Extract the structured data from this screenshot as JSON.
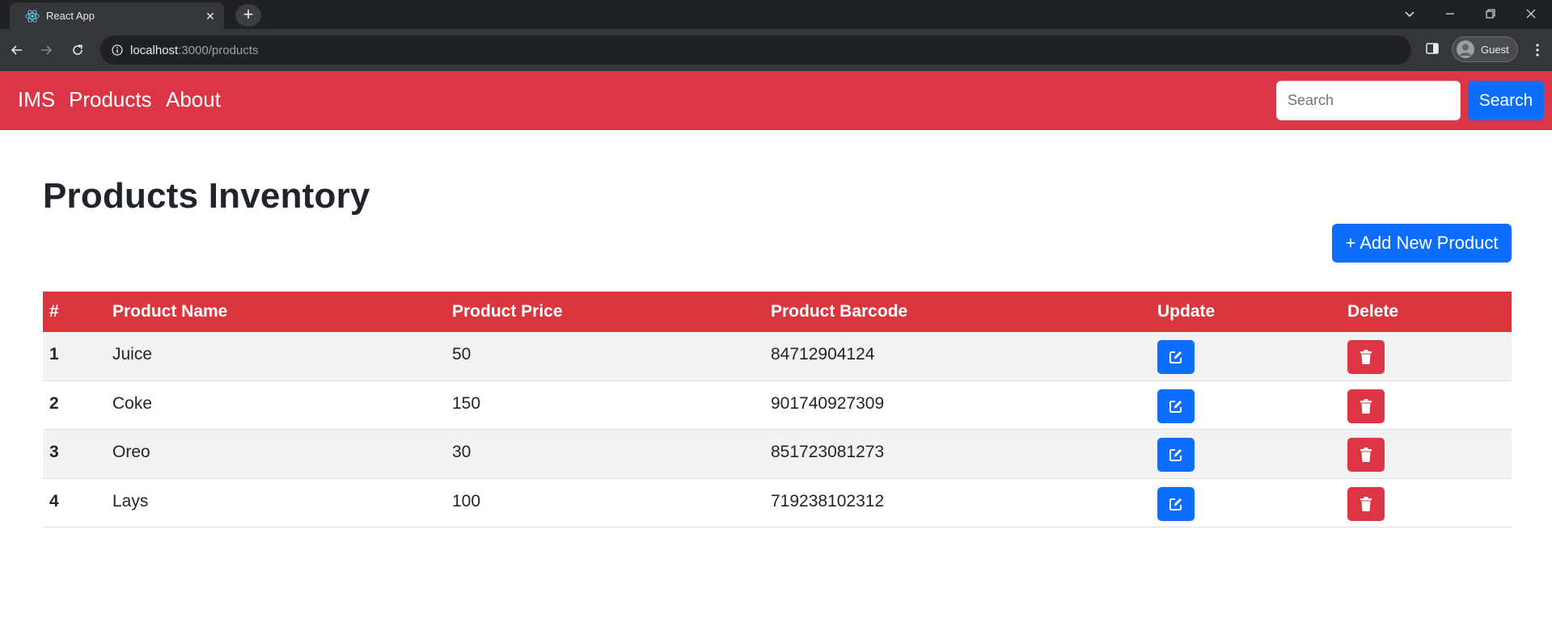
{
  "browser": {
    "tab_title": "React App",
    "tab_close_glyph": "✕",
    "new_tab_glyph": "+",
    "url_host": "localhost",
    "url_path": ":3000/products",
    "profile_label": "Guest",
    "icons": [
      "react-logo-icon",
      "close-icon",
      "plus-icon",
      "chevron-down-icon",
      "minimize-icon",
      "restore-icon",
      "window-close-icon",
      "back-arrow-icon",
      "forward-arrow-icon",
      "reload-icon",
      "info-icon",
      "side-panel-icon",
      "profile-avatar-icon",
      "kebab-menu-icon"
    ]
  },
  "navbar": {
    "brand": "IMS",
    "links": [
      "Products",
      "About"
    ],
    "search_placeholder": "Search",
    "search_button": "Search",
    "background": "#dc3545"
  },
  "main": {
    "title": "Products Inventory",
    "add_button": "+ Add New Product",
    "table": {
      "headers": [
        "#",
        "Product Name",
        "Product Price",
        "Product Barcode",
        "Update",
        "Delete"
      ],
      "rows": [
        {
          "idx": "1",
          "name": "Juice",
          "price": "50",
          "barcode": "84712904124"
        },
        {
          "idx": "2",
          "name": "Coke",
          "price": "150",
          "barcode": "901740927309"
        },
        {
          "idx": "3",
          "name": "Oreo",
          "price": "30",
          "barcode": "851723081273"
        },
        {
          "idx": "4",
          "name": "Lays",
          "price": "100",
          "barcode": "719238102312"
        }
      ]
    }
  },
  "colors": {
    "accent": "#0d6efd",
    "danger": "#dc3545",
    "table_header": "#d9363e",
    "row_stripe": "#f2f2f2"
  }
}
